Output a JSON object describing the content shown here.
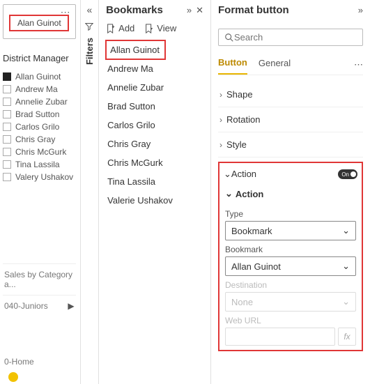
{
  "canvas": {
    "button_text": "Alan Guinot",
    "dm_title": "District Manager",
    "dm_items": [
      {
        "label": "Allan Guinot",
        "checked": true
      },
      {
        "label": "Andrew Ma",
        "checked": false
      },
      {
        "label": "Annelie Zubar",
        "checked": false
      },
      {
        "label": "Brad Sutton",
        "checked": false
      },
      {
        "label": "Carlos Grilo",
        "checked": false
      },
      {
        "label": "Chris Gray",
        "checked": false
      },
      {
        "label": "Chris McGurk",
        "checked": false
      },
      {
        "label": "Tina Lassila",
        "checked": false
      },
      {
        "label": "Valery Ushakov",
        "checked": false
      }
    ],
    "lower1": "Sales by Category a...",
    "lower2": "040-Juniors",
    "lower3": "0-Home"
  },
  "filters": {
    "label": "Filters"
  },
  "bookmarks": {
    "title": "Bookmarks",
    "add_label": "Add",
    "view_label": "View",
    "items": [
      {
        "label": "Allan Guinot",
        "selected": true
      },
      {
        "label": "Andrew Ma",
        "selected": false
      },
      {
        "label": "Annelie Zubar",
        "selected": false
      },
      {
        "label": "Brad Sutton",
        "selected": false
      },
      {
        "label": "Carlos Grilo",
        "selected": false
      },
      {
        "label": "Chris Gray",
        "selected": false
      },
      {
        "label": "Chris McGurk",
        "selected": false
      },
      {
        "label": "Tina Lassila",
        "selected": false
      },
      {
        "label": "Valerie Ushakov",
        "selected": false
      }
    ]
  },
  "format": {
    "title": "Format button",
    "search_placeholder": "Search",
    "tabs": {
      "button": "Button",
      "general": "General"
    },
    "rows": {
      "shape": "Shape",
      "rotation": "Rotation",
      "style": "Style"
    },
    "action": {
      "header": "Action",
      "toggle_label": "On",
      "sub_header": "Action",
      "type_label": "Type",
      "type_value": "Bookmark",
      "bookmark_label": "Bookmark",
      "bookmark_value": "Allan Guinot",
      "destination_label": "Destination",
      "destination_value": "None",
      "weburl_label": "Web URL",
      "fx_label": "fx"
    }
  }
}
